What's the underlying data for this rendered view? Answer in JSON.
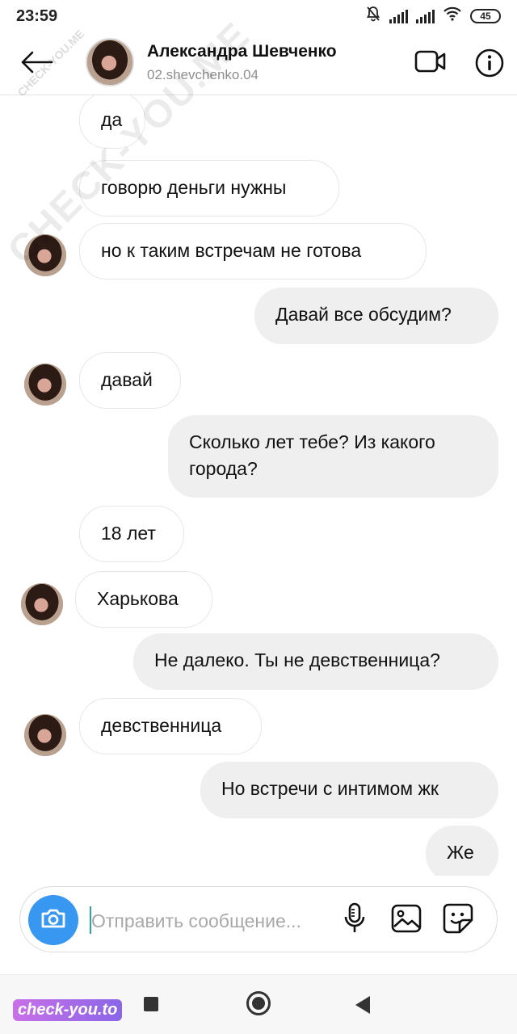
{
  "status_bar": {
    "time": "23:59",
    "battery": "45",
    "icons": [
      "bell-off-icon",
      "signal-icon",
      "signal-icon",
      "wifi-icon",
      "battery-icon"
    ]
  },
  "header": {
    "name": "Александра Шевченко",
    "username": "02.shevchenko.04",
    "icons": [
      "back-arrow-icon",
      "video-call-icon",
      "info-icon"
    ]
  },
  "messages": [
    {
      "side": "in",
      "text": "да",
      "avatar": false
    },
    {
      "side": "in",
      "text": "говорю деньги нужны",
      "avatar": false
    },
    {
      "side": "in",
      "text": "но к таким встречам не готова",
      "avatar": true
    },
    {
      "side": "out",
      "text": "Давай все обсудим?"
    },
    {
      "side": "in",
      "text": "давай",
      "avatar": true
    },
    {
      "side": "out",
      "text": "Сколько лет тебе? Из какого города?"
    },
    {
      "side": "in",
      "text": "18 лет",
      "avatar": false
    },
    {
      "side": "in",
      "text": "Харькова",
      "avatar": true
    },
    {
      "side": "out",
      "text": "Не далеко. Ты не девственница?"
    },
    {
      "side": "in",
      "text": "девственница",
      "avatar": true
    },
    {
      "side": "out",
      "text": "Но встречи с интимом жк"
    },
    {
      "side": "out",
      "text": "Же"
    }
  ],
  "composer": {
    "placeholder": "Отправить сообщение...",
    "value": "",
    "icons": [
      "camera-icon",
      "microphone-icon",
      "gallery-icon",
      "sticker-icon"
    ]
  },
  "navigation": {
    "icons": [
      "recents-square-icon",
      "home-circle-icon",
      "back-triangle-icon"
    ]
  },
  "watermarks": {
    "diagonal": "CHECK-YOU.ME",
    "small": "CHECK-YOU.ME",
    "bottom": "check-you.to"
  },
  "colors": {
    "accent": "#3897f0",
    "outgoing_bubble": "#efefef",
    "incoming_border": "#e6e6e6",
    "username_gray": "#8e8e8e"
  }
}
